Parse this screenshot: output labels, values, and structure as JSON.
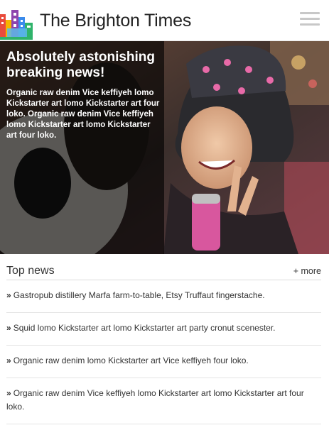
{
  "header": {
    "site_title": "The Brighton Times",
    "logo_icon": "city-skyline-icon",
    "menu_icon": "hamburger-menu-icon"
  },
  "hero": {
    "headline": "Absolutely astonishing breaking news!",
    "excerpt": "Organic raw denim Vice keffiyeh lomo Kickstarter art lomo Kickstarter art four loko. Organic raw denim Vice keffiyeh lomo Kickstarter art lomo Kickstarter art four loko."
  },
  "top_news": {
    "title": "Top news",
    "more_label": "+ more",
    "bullet": "»",
    "items": [
      {
        "text": "Gastropub distillery Marfa farm-to-table, Etsy Truffaut fingerstache."
      },
      {
        "text": "Squid lomo Kickstarter art lomo Kickstarter art party cronut scenester."
      },
      {
        "text": "Organic raw denim lomo Kickstarter art Vice keffiyeh four loko."
      },
      {
        "text": "Organic raw denim Vice keffiyeh lomo Kickstarter art lomo Kickstarter art four loko."
      }
    ]
  }
}
